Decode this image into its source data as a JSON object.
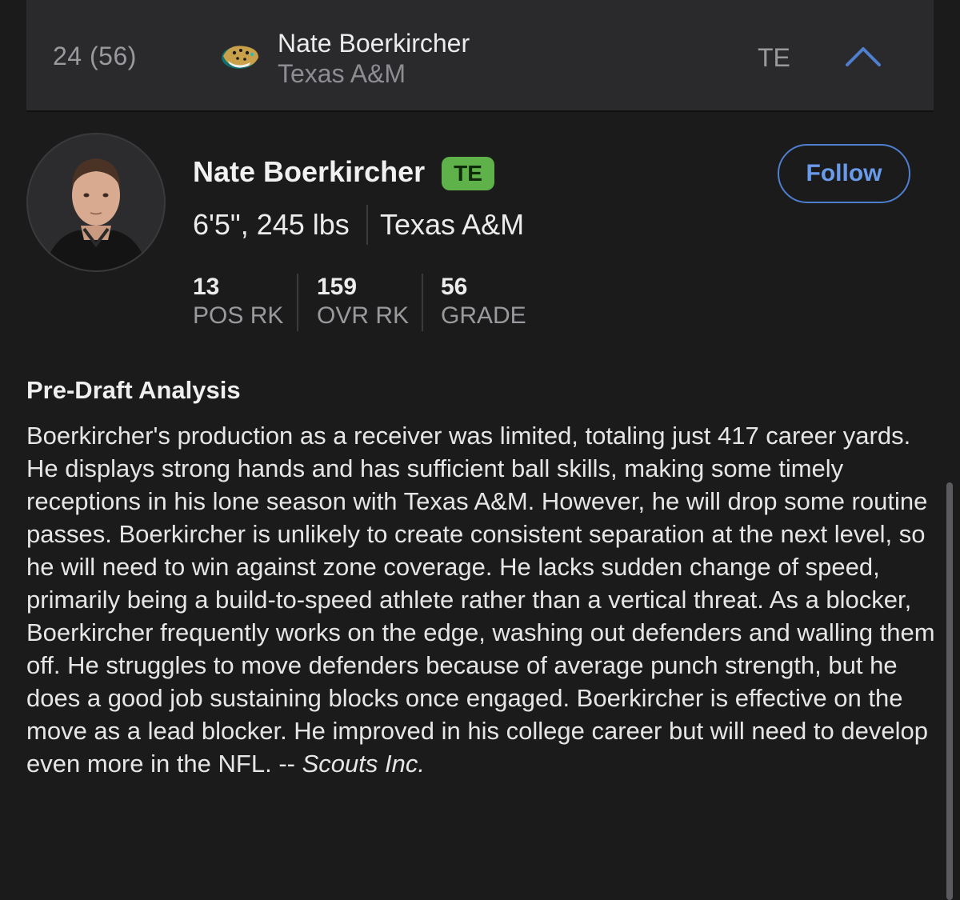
{
  "pick": {
    "number": "24 (56)",
    "player_name": "Nate Boerkircher",
    "school": "Texas A&M",
    "position": "TE",
    "team_logo_icon": "jaguars-logo-icon"
  },
  "player": {
    "name": "Nate Boerkircher",
    "position_badge": "TE",
    "measurables": "6'5\", 245 lbs",
    "school": "Texas A&M",
    "follow_label": "Follow",
    "stats": [
      {
        "value": "13",
        "label": "POS RK"
      },
      {
        "value": "159",
        "label": "OVR RK"
      },
      {
        "value": "56",
        "label": "GRADE"
      }
    ]
  },
  "analysis": {
    "title": "Pre-Draft Analysis",
    "body": "Boerkircher's production as a receiver was limited, totaling just 417 career yards. He displays strong hands and has sufficient ball skills, making some timely receptions in his lone season with Texas A&M. However, he will drop some routine passes. Boerkircher is unlikely to create consistent separation at the next level, so he will need to win against zone coverage. He lacks sudden change of speed, primarily being a build-to-speed athlete rather than a vertical threat. As a blocker, Boerkircher frequently works on the edge, washing out defenders and walling them off. He struggles to move defenders because of average punch strength, but he does a good job sustaining blocks once engaged. Boerkircher is effective on the move as a lead blocker. He improved in his college career but will need to develop even more in the NFL. -- ",
    "credit": "Scouts Inc."
  },
  "colors": {
    "background": "#1b1b1c",
    "row_background": "#2a2a2c",
    "badge_green": "#5fb24a",
    "accent_blue": "#4f7fcf"
  }
}
